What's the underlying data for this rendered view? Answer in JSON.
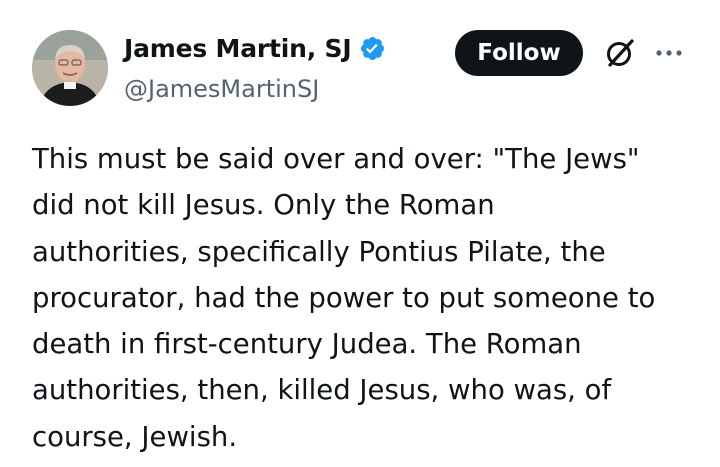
{
  "author": {
    "display_name": "James Martin, SJ",
    "handle": "@JamesMartinSJ",
    "verified": true
  },
  "actions": {
    "follow_label": "Follow"
  },
  "icons": {
    "verified": "verified-badge-icon",
    "grok": "grok-icon",
    "more": "more-options-icon"
  },
  "colors": {
    "verified_blue": "#1d9bf0",
    "button_bg": "#0f1419",
    "text_primary": "#0f1419",
    "text_secondary": "#536471"
  },
  "tweet": {
    "lines": [
      "This must be said over and over: \"The Jews\"",
      "did not kill Jesus. Only the Roman",
      "authorities, specifically Pontius Pilate, the",
      "procurator, had the power to put someone to",
      "death in first-century Judea. The Roman",
      "authorities, then, killed Jesus, who was, of",
      "course, Jewish."
    ]
  }
}
